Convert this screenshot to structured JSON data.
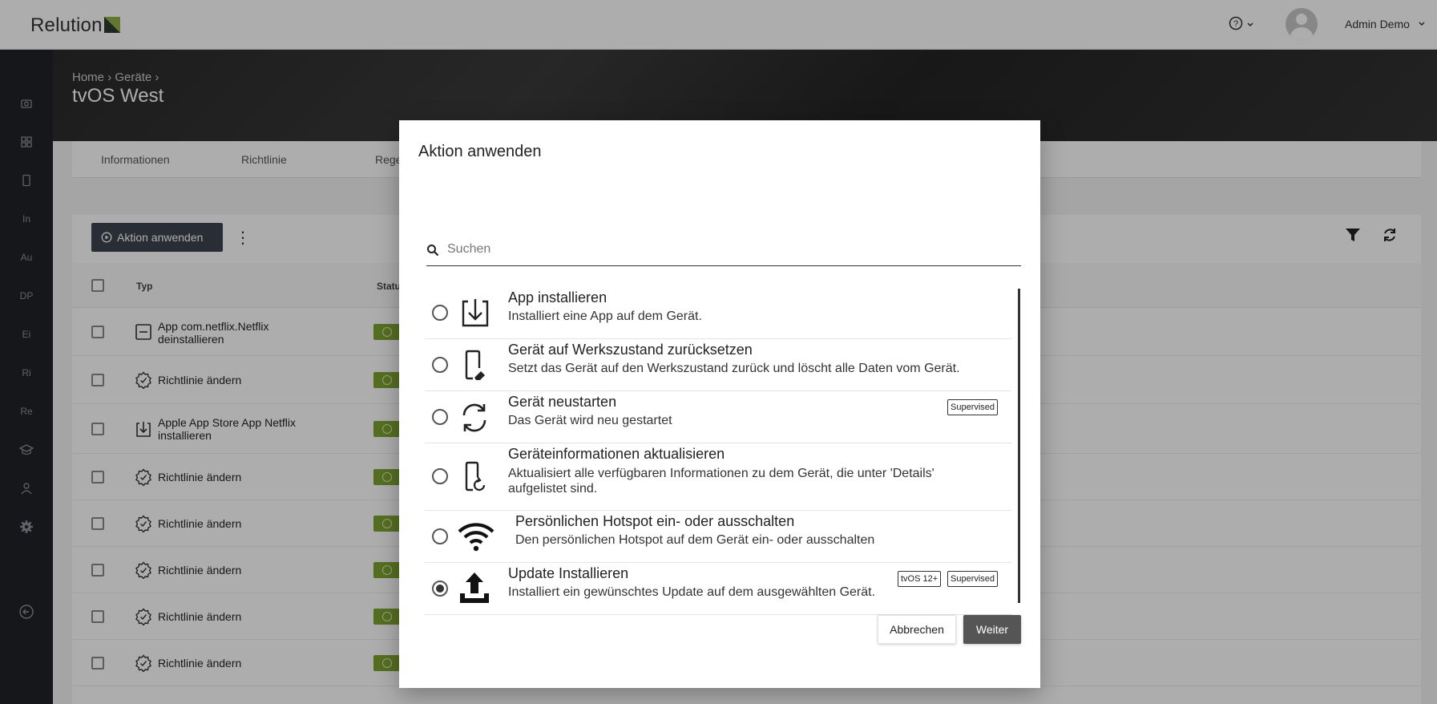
{
  "app": {
    "logo": "Relution"
  },
  "topbar": {
    "help_label": "?",
    "user_name": "Admin Demo"
  },
  "sidebar": {
    "items": [
      {
        "icon": "camera-icon",
        "label": ""
      },
      {
        "icon": "grid-icon",
        "label": ""
      },
      {
        "icon": "phone-icon",
        "label": ""
      },
      {
        "icon": "text-icon",
        "label": "In"
      },
      {
        "icon": "text-icon",
        "label": "Au"
      },
      {
        "icon": "text-icon",
        "label": "DP"
      },
      {
        "icon": "text-icon",
        "label": "Ei"
      },
      {
        "icon": "text-icon",
        "label": "Ri"
      },
      {
        "icon": "text-icon",
        "label": "Re"
      },
      {
        "icon": "graduation-icon",
        "label": ""
      },
      {
        "icon": "person-icon",
        "label": ""
      },
      {
        "icon": "gear-icon",
        "label": ""
      },
      {
        "icon": "logout-icon",
        "label": ""
      }
    ]
  },
  "breadcrumb": {
    "home": "Home",
    "devices": "Geräte"
  },
  "page_title": "tvOS West",
  "tabs": [
    "Informationen",
    "Richtlinie",
    "Rege"
  ],
  "toolbar": {
    "apply_label": "Aktion anwenden"
  },
  "table": {
    "headers": {
      "type": "Typ",
      "status": "Statu"
    },
    "rows": [
      {
        "icon": "app-remove-icon",
        "text": "App com.netflix.Netflix\ndeinstallieren"
      },
      {
        "icon": "policy-gear-icon",
        "text": "Richtlinie ändern"
      },
      {
        "icon": "app-install-icon",
        "text": "Apple App Store App Netflix\ninstallieren"
      },
      {
        "icon": "policy-gear-icon",
        "text": "Richtlinie ändern"
      },
      {
        "icon": "policy-gear-icon",
        "text": "Richtlinie ändern"
      },
      {
        "icon": "policy-gear-icon",
        "text": "Richtlinie ändern"
      },
      {
        "icon": "policy-gear-icon",
        "text": "Richtlinie ändern"
      },
      {
        "icon": "policy-gear-icon",
        "text": "Richtlinie ändern"
      }
    ]
  },
  "modal": {
    "title": "Aktion anwenden",
    "search_placeholder": "Suchen",
    "actions": [
      {
        "title": "App installieren",
        "desc": "Installiert eine App auf dem Gerät.",
        "icon": "app-install-icon",
        "badges": [],
        "selected": false
      },
      {
        "title": "Gerät auf Werkszustand zurücksetzen",
        "desc": "Setzt das Gerät auf den Werkszustand zurück und löscht alle Daten vom Gerät.",
        "icon": "device-erase-icon",
        "badges": [],
        "selected": false
      },
      {
        "title": "Gerät neustarten",
        "desc": "Das Gerät wird neu gestartet",
        "icon": "restart-icon",
        "badges": [
          "Supervised"
        ],
        "selected": false
      },
      {
        "title": "Geräteinformationen aktualisieren",
        "desc": "Aktualisiert alle verfügbaren Informationen zu dem Gerät, die unter 'Details' aufgelistet sind.",
        "icon": "device-refresh-icon",
        "badges": [],
        "selected": false
      },
      {
        "title": "Persönlichen Hotspot ein- oder ausschalten",
        "desc": "Den persönlichen Hotspot auf dem Gerät ein- oder ausschalten",
        "icon": "wifi-icon",
        "badges": [],
        "selected": false
      },
      {
        "title": "Update Installieren",
        "desc": "Installiert ein gewünschtes Update auf dem ausgewählten Gerät.",
        "icon": "upload-icon",
        "badges": [
          "tvOS 12+",
          "Supervised"
        ],
        "selected": true
      }
    ],
    "cancel_label": "Abbrechen",
    "next_label": "Weiter"
  }
}
